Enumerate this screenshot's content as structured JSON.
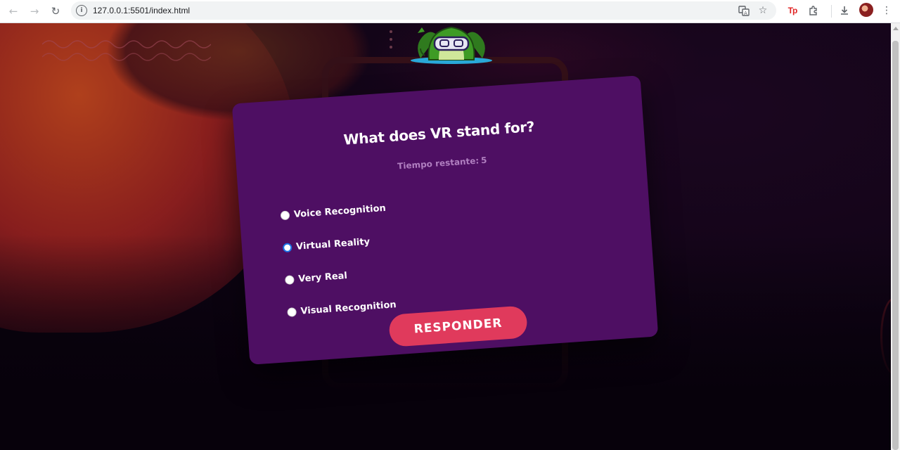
{
  "browser": {
    "url": "127.0.0.1:5501/index.html",
    "icons": [
      "back-arrow-icon",
      "forward-arrow-icon",
      "reload-icon",
      "site-info-icon",
      "translate-icon",
      "bookmark-star-icon",
      "tp-extension-icon",
      "extensions-puzzle-icon",
      "download-icon",
      "profile-avatar",
      "menu-kebab-icon"
    ],
    "tp_label": "Tp"
  },
  "quiz": {
    "question": "What does VR stand for?",
    "timer_label": "Tiempo restante:",
    "timer_value": "5",
    "options": [
      {
        "label": "Voice Recognition",
        "checked": false
      },
      {
        "label": "Virtual Reality",
        "checked": true
      },
      {
        "label": "Very Real",
        "checked": false
      },
      {
        "label": "Visual Recognition",
        "checked": false
      }
    ],
    "submit_label": "RESPONDER"
  },
  "colors": {
    "card": "#4e0f63",
    "button": "#e03a5c",
    "radio_selected": "#1a73e8",
    "timer_text": "#b07fc0"
  }
}
